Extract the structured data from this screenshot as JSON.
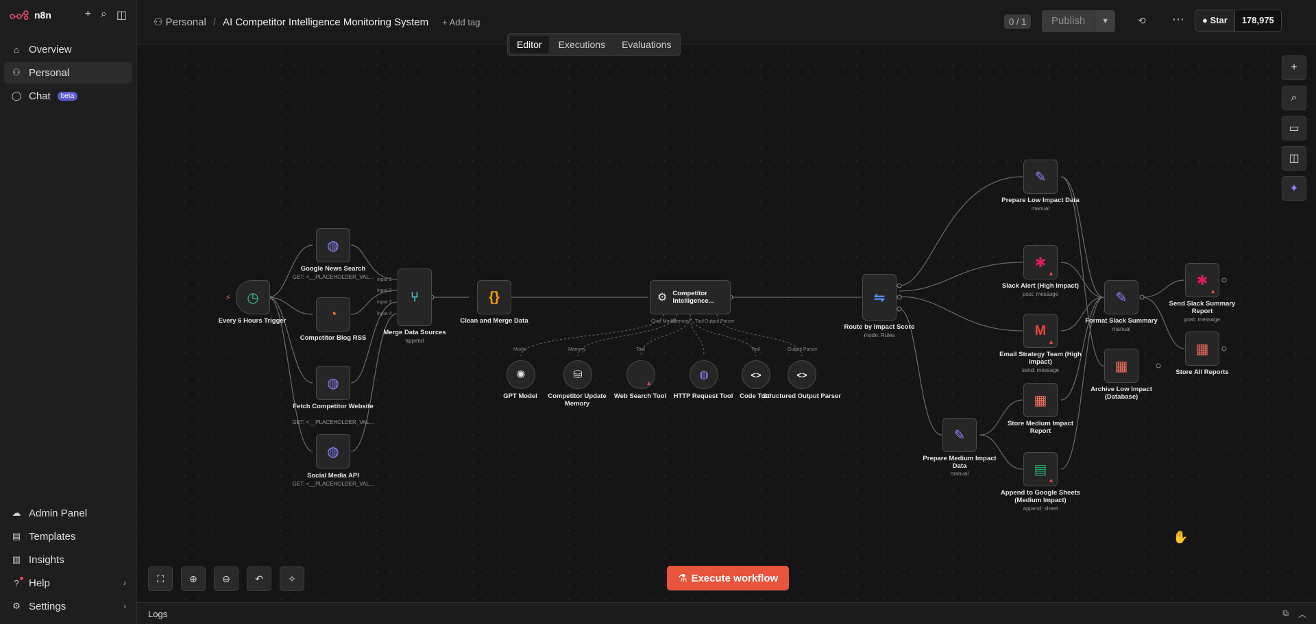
{
  "sidebar": {
    "brand": "n8n",
    "items": [
      {
        "label": "Overview"
      },
      {
        "label": "Personal"
      },
      {
        "label": "Chat",
        "badge": "beta"
      }
    ],
    "bottom": [
      {
        "label": "Admin Panel"
      },
      {
        "label": "Templates"
      },
      {
        "label": "Insights"
      },
      {
        "label": "Help"
      },
      {
        "label": "Settings"
      }
    ]
  },
  "header": {
    "project": "Personal",
    "workflow_title": "AI Competitor Intelligence Monitoring System",
    "add_tag": "+ Add tag",
    "version": "0 / 1",
    "publish": "Publish",
    "github_star": "Star",
    "github_count": "178,975",
    "tabs": [
      "Editor",
      "Executions",
      "Evaluations"
    ]
  },
  "nodes": {
    "trigger": {
      "label": "Every 6 Hours Trigger"
    },
    "google_news": {
      "label": "Google News Search",
      "sub": "GET: <__PLACEHOLDER_VAL..."
    },
    "blog_rss": {
      "label": "Competitor Blog RSS"
    },
    "fetch_site": {
      "label": "Fetch Competitor Website",
      "sub": "GET: <__PLACEHOLDER_VAL..."
    },
    "social": {
      "label": "Social Media API",
      "sub": "GET: <__PLACEHOLDER_VAL..."
    },
    "merge": {
      "label": "Merge Data Sources",
      "sub": "append",
      "inputs": [
        "Input 1",
        "Input 2",
        "Input 3",
        "Input 4"
      ]
    },
    "clean": {
      "label": "Clean and Merge Data"
    },
    "agent": {
      "label": "Competitor Intelligence...",
      "handles": [
        "Chat Model",
        "Memory",
        "Tool",
        "Output Parser"
      ]
    },
    "gpt": {
      "label": "GPT Model",
      "handle": "Model"
    },
    "memory": {
      "label": "Competitor Update Memory",
      "handle": "Memory"
    },
    "websearch": {
      "label": "Web Search Tool",
      "handle": "Tool"
    },
    "httptool": {
      "label": "HTTP Request Tool"
    },
    "codetool": {
      "label": "Code Tool",
      "handle": "Tool"
    },
    "parser": {
      "label": "Structured Output Parser",
      "handle": "Output Parser"
    },
    "route": {
      "label": "Route by Impact Score",
      "sub": "mode: Rules"
    },
    "prep_low": {
      "label": "Prepare Low Impact Data",
      "sub": "manual"
    },
    "slack_alert": {
      "label": "Slack Alert (High Impact)",
      "sub": "post: message"
    },
    "email": {
      "label": "Email Strategy Team (High Impact)",
      "sub": "send: message"
    },
    "store_med": {
      "label": "Store Medium Impact Report"
    },
    "prep_med": {
      "label": "Prepare Medium Impact Data",
      "sub": "manual"
    },
    "sheets": {
      "label": "Append to Google Sheets (Medium Impact)",
      "sub": "append: sheet"
    },
    "format_slack": {
      "label": "Format Slack Summary",
      "sub": "manual"
    },
    "archive_low": {
      "label": "Archive Low Impact (Database)"
    },
    "send_slack": {
      "label": "Send Slack Summary Report",
      "sub": "post: message"
    },
    "store_all": {
      "label": "Store All Reports"
    }
  },
  "execute": "Execute workflow",
  "logs": "Logs"
}
